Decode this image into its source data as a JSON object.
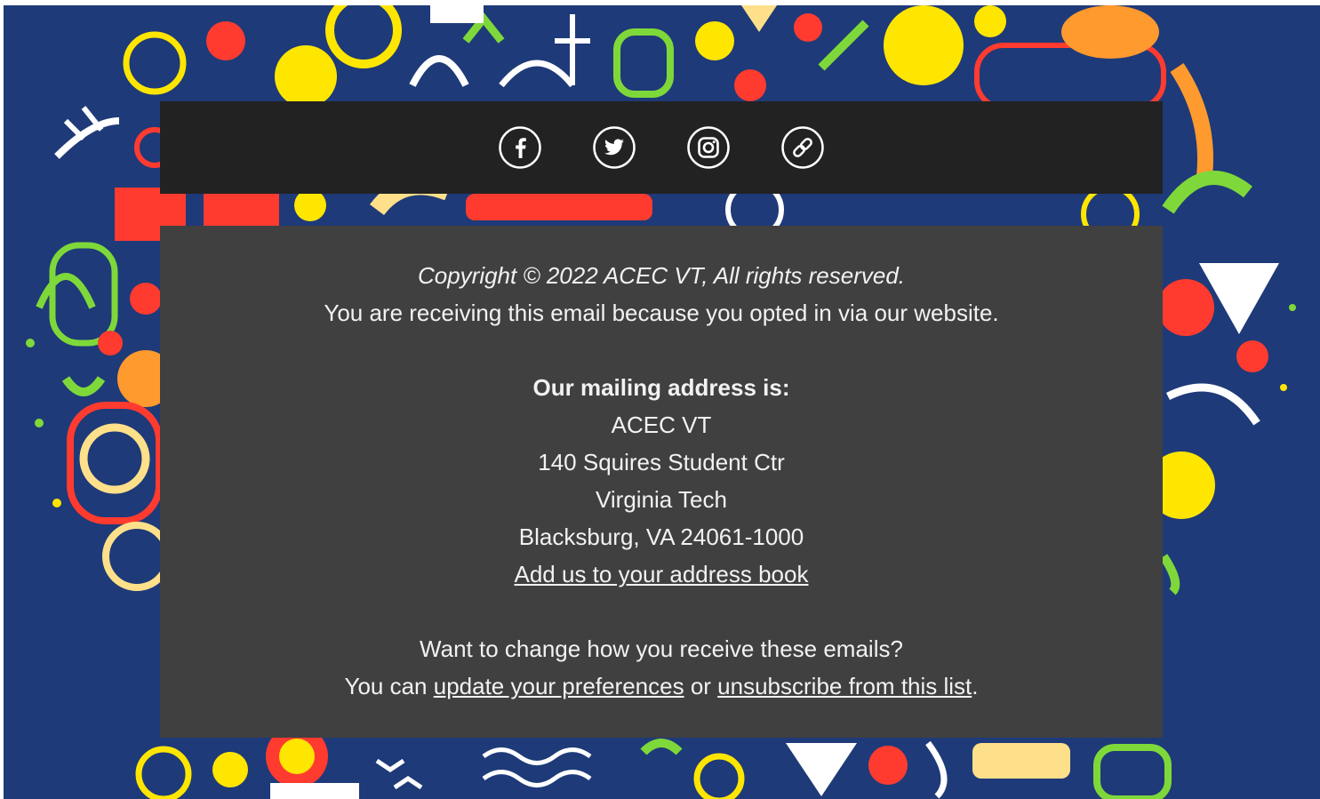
{
  "social": {
    "items": [
      {
        "name": "facebook",
        "icon": "facebook-icon"
      },
      {
        "name": "twitter",
        "icon": "twitter-icon"
      },
      {
        "name": "instagram",
        "icon": "instagram-icon"
      },
      {
        "name": "website",
        "icon": "link-icon"
      }
    ]
  },
  "footer": {
    "copyright": "Copyright © 2022 ACEC VT, All rights reserved.",
    "opt_in_notice": "You are receiving this email because you opted in via our website.",
    "mailing_heading": "Our mailing address is:",
    "address": {
      "org": "ACEC VT",
      "street": "140 Squires Student Ctr",
      "building": "Virginia Tech",
      "city_state_zip": "Blacksburg, VA 24061-1000"
    },
    "add_address_book": "Add us to your address book",
    "change_prompt": "Want to change how you receive these emails?",
    "you_can": "You can ",
    "update_preferences": "update your preferences",
    "or": " or ",
    "unsubscribe": "unsubscribe from this list",
    "period": "."
  },
  "colors": {
    "background": "#1e3a78",
    "social_bar": "#222222",
    "footer_box": "#404040",
    "text": "#f2f2f2"
  }
}
